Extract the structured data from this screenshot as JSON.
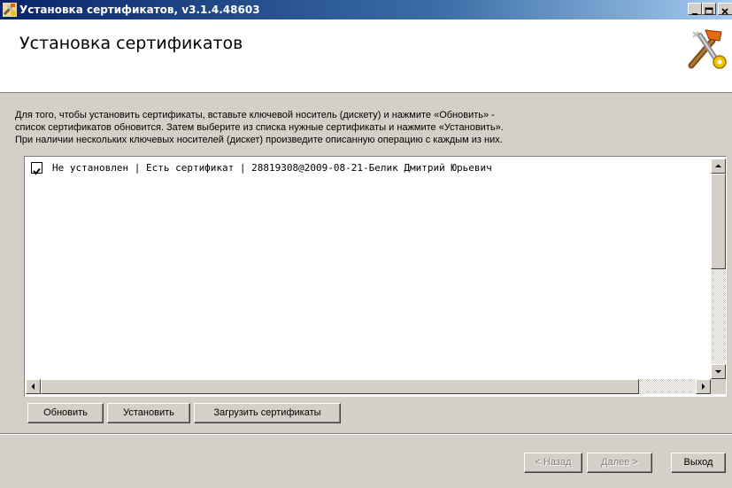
{
  "window": {
    "title": "Установка сертификатов, v3.1.4.48603"
  },
  "header": {
    "title": "Установка сертификатов"
  },
  "instructions": {
    "line1": "Для того, чтобы установить сертификаты, вставьте ключевой носитель (дискету) и нажмите «Обновить» -",
    "line2": "список сертификатов обновится. Затем выберите из списка нужные сертификаты и нажмите «Установить».",
    "line3": "При наличии нескольких ключевых носителей (дискет) произведите описанную операцию с каждым из них."
  },
  "certificates": [
    {
      "checked": true,
      "text": "Не установлен | Есть сертификат | 28819308@2009-08-21-Белик Дмитрий Юрьевич"
    }
  ],
  "actions": {
    "refresh": "Обновить",
    "install": "Установить",
    "load": "Загрузить сертификаты"
  },
  "navigation": {
    "back": "< Назад",
    "next": "Далее >",
    "exit": "Выход"
  },
  "colors": {
    "titlebar_start": "#0a246a",
    "titlebar_end": "#a6caf0",
    "face": "#d4d0c8"
  }
}
